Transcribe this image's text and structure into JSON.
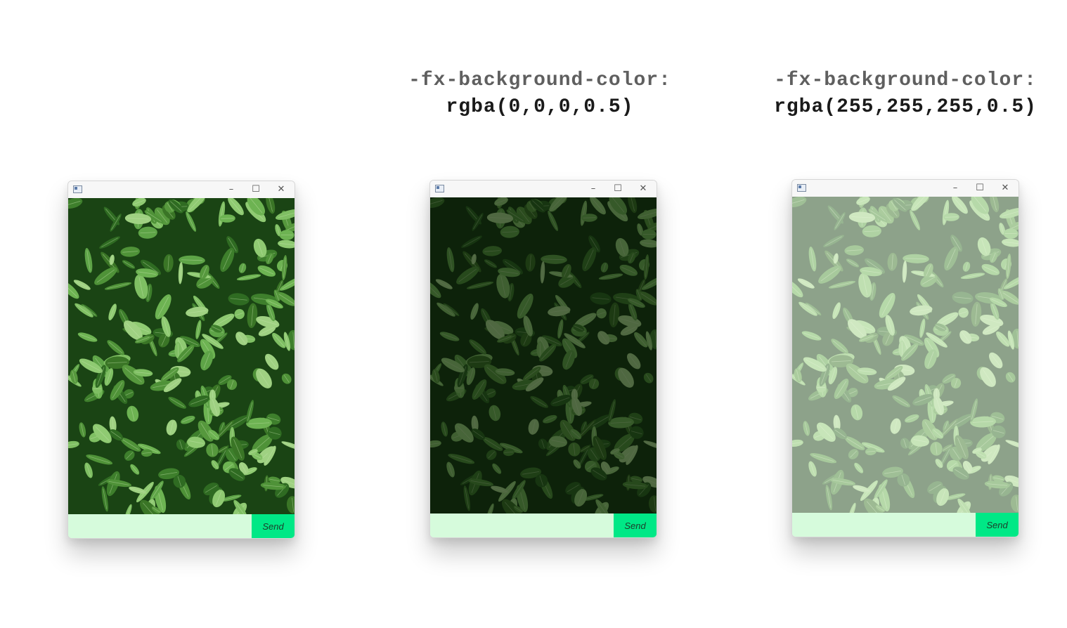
{
  "captions": [
    {
      "property": "",
      "value": ""
    },
    {
      "property": "-fx-background-color:",
      "value": "rgba(0,0,0,0.5)"
    },
    {
      "property": "-fx-background-color:",
      "value": "rgba(255,255,255,0.5)"
    }
  ],
  "windows": [
    {
      "overlay_color": "transparent",
      "input": {
        "value": "",
        "placeholder": ""
      },
      "send_label": "Send"
    },
    {
      "overlay_color": "rgba(0,0,0,0.5)",
      "input": {
        "value": "",
        "placeholder": ""
      },
      "send_label": "Send"
    },
    {
      "overlay_color": "rgba(255,255,255,0.5)",
      "input": {
        "value": "",
        "placeholder": ""
      },
      "send_label": "Send"
    }
  ],
  "window_controls": {
    "minimize": "–",
    "maximize": "☐",
    "close": "✕"
  },
  "icons": {
    "app": "app-window-icon",
    "minimize": "minimize-icon",
    "maximize": "maximize-icon",
    "close": "close-icon"
  },
  "colors": {
    "input_background": "#d6fbdc",
    "send_button": "#00e886",
    "titlebar": "#f7f7f7"
  }
}
